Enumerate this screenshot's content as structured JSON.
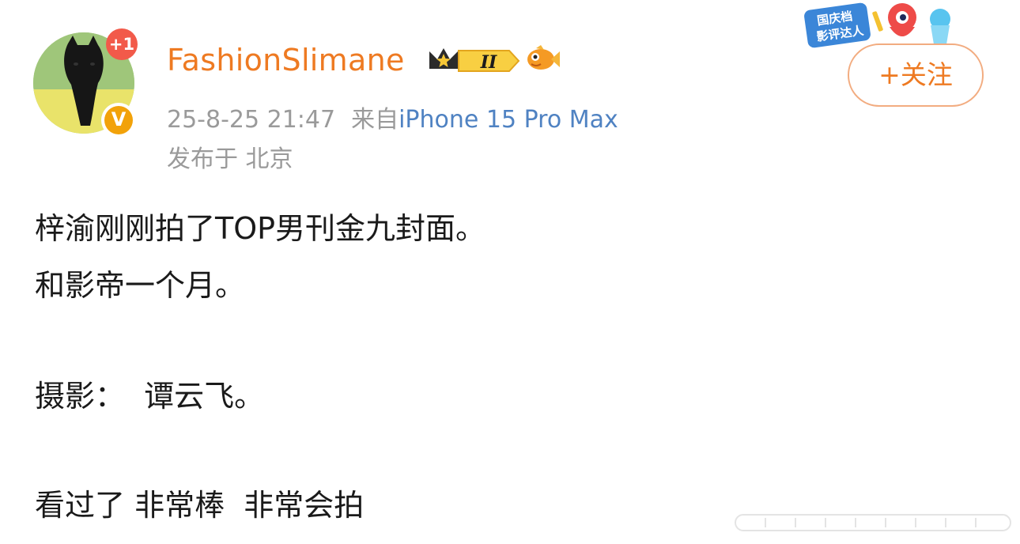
{
  "author": {
    "username": "FashionSlimane",
    "notification_badge": "+1",
    "verified_badge": "V",
    "level_badge": "II"
  },
  "meta": {
    "timestamp": "25-8-25 21:47",
    "source_prefix": "来自",
    "device": "iPhone 15 Pro Max",
    "location": "发布于 北京"
  },
  "follow_button": {
    "label": "+关注"
  },
  "event_sticker": {
    "line1": "国庆档",
    "line2": "影评达人"
  },
  "post": {
    "lines": [
      "梓渝刚刚拍了TOP男刊金九封面。",
      "和影帝一个月。",
      "摄影：  谭云飞。",
      "看过了 非常棒  非常会拍"
    ]
  },
  "colors": {
    "username": "#ee7a22",
    "device_link": "#4f82c2",
    "meta_gray": "#9a9a9a",
    "follow_border": "#f2ac80",
    "badge_red": "#f25a4a",
    "verified_orange": "#f2a20a"
  },
  "icons": [
    "crown-icon",
    "level-icon",
    "fish-icon",
    "verified-icon",
    "event-sticker"
  ]
}
